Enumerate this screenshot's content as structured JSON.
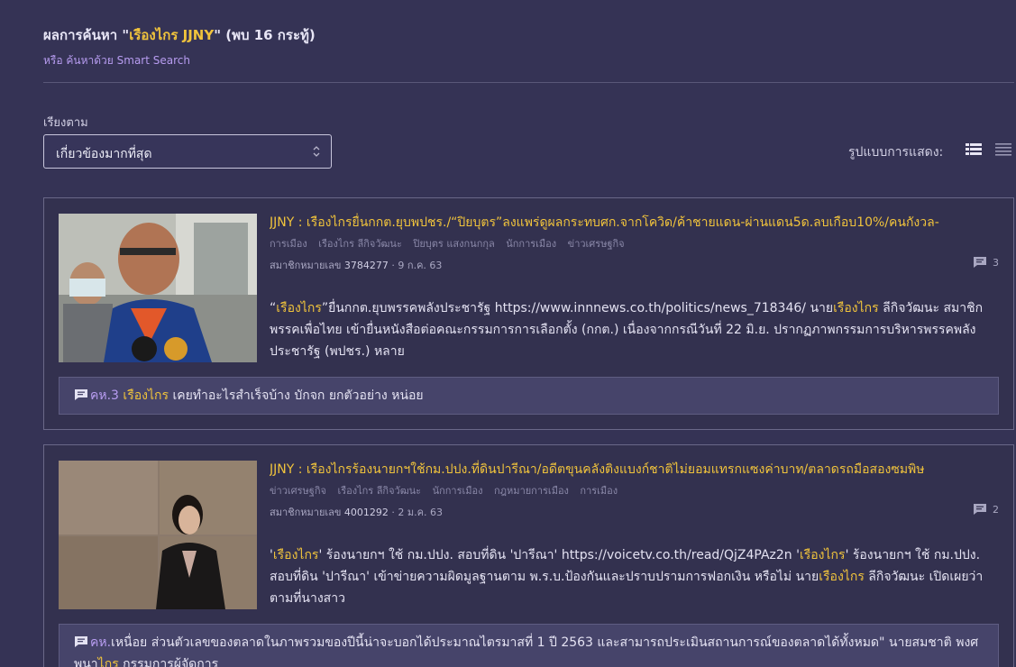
{
  "header": {
    "prefix": "ผลการค้นหา \"",
    "query": "เรืองไกร JJNY",
    "suffix": "\" (พบ 16 กระทู้)",
    "smart_search": "หรือ ค้นหาด้วย Smart Search"
  },
  "sort": {
    "label": "เรียงตาม",
    "selected": "เกี่ยวข้องมากที่สุด"
  },
  "view": {
    "label": "รูปแบบการแสดง:"
  },
  "results": [
    {
      "title_prefix": "JJNY : ",
      "title_highlight": "เรืองไกร",
      "title_rest": "ยื่นกกต.ยุบพปชร./“ปิยบุตร”ลงแพร่ดูผลกระทบศก.จากโควิด/ค้าชายแดน-ผ่านแดน5ด.ลบเกือบ10%/คนกังวล-",
      "tags": [
        "การเมือง",
        "เรืองไกร ลีกิจวัฒนะ",
        "ปิยบุตร แสงกนกกุล",
        "นักการเมือง",
        "ข่าวเศรษฐกิจ"
      ],
      "member_label": "สมาชิกหมายเลข",
      "member_id": "3784277",
      "date": "· 9 ก.ค. 63",
      "comment_count": "3",
      "excerpt": {
        "p1": "“",
        "h1": "เรืองไกร",
        "p2": "”ยื่นกกต.ยุบพรรคพลังประชารัฐ https://www.innnews.co.th/politics/news_718346/ นาย",
        "h2": "เรืองไกร",
        "p3": " ลีกิจวัฒนะ สมาชิกพรรคเพื่อไทย เข้ายื่นหนังสือต่อคณะกรรมการการเลือกตั้ง (กกต.) เนื่องจากกรณีวันที่ 22 มิ.ย. ปรากฏภาพกรรมการบริหารพรรคพลังประชารัฐ (พปชร.) หลาย"
      },
      "comment": {
        "label": "คห.3 ",
        "h1": "เรืองไกร",
        "text": " เคยทำอะไรสำเร็จบ้าง บักจก ยกตัวอย่าง หน่อย"
      }
    },
    {
      "title_prefix": "JJNY : ",
      "title_highlight": "เรืองไกร",
      "title_rest": "ร้องนายกฯใช้กม.ปปง.ที่ดินปารีณา/อดีตขุนคลังติงแบงก์ชาติไม่ยอมแทรกแซงค่าบาท/ตลาดรถมือสองซมพิษ",
      "tags": [
        "ข่าวเศรษฐกิจ",
        "เรืองไกร ลีกิจวัฒนะ",
        "นักการเมือง",
        "กฎหมายการเมือง",
        "การเมือง"
      ],
      "member_label": "สมาชิกหมายเลข",
      "member_id": "4001292",
      "date": "· 2 ม.ค. 63",
      "comment_count": "2",
      "excerpt": {
        "p1": "'",
        "h1": "เรืองไกร",
        "p2": "' ร้องนายกฯ ใช้ กม.ปปง. สอบที่ดิน 'ปารีณา' https://voicetv.co.th/read/QjZ4PAz2n '",
        "h2": "เรืองไกร",
        "p3": "' ร้องนายกฯ ใช้ กม.ปปง. สอบที่ดิน 'ปารีณา' เข้าข่ายความผิดมูลฐานตาม พ.ร.บ.ป้องกันและปราบปรามการฟอกเงิน หรือไม่ นาย",
        "h3": "เรืองไกร",
        "p4": " ลีกิจวัฒนะ เปิดเผยว่า ตามที่นางสาว"
      },
      "comment": {
        "label": "คห.",
        "text": "เหนื่อย ส่วนตัวเลขของตลาดในภาพรวมของปีนี้น่าจะบอกได้ประมาณไตรมาสที่ 1 ปี 2563 และสามารถประเมินสถานการณ์ของตลาดได้ทั้งหมด\" นายสมชาติ พงศพนา",
        "h1": "ไกร",
        "text2": " กรรมการผู้จัดการ"
      }
    }
  ]
}
